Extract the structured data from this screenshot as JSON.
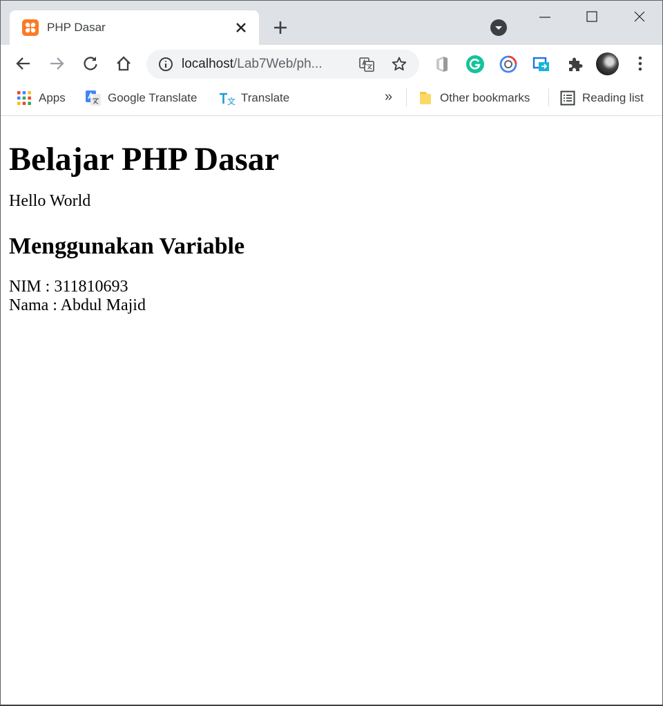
{
  "browser": {
    "tab": {
      "title": "PHP Dasar",
      "favicon": "xampp-icon"
    },
    "address_bar": {
      "host": "localhost",
      "path": "/Lab7Web/ph..."
    },
    "bookmarks": {
      "apps": "Apps",
      "google_translate": "Google Translate",
      "translate": "Translate",
      "more": "»",
      "other_bookmarks": "Other bookmarks",
      "reading_list": "Reading list"
    },
    "colors": {
      "tabstrip": "#dee1e6",
      "omnibox": "#f1f3f4",
      "favicon": "#fb7a24"
    }
  },
  "page": {
    "heading": "Belajar PHP Dasar",
    "hello": "Hello World",
    "subheading": "Menggunakan Variable",
    "nim_line": "NIM : 311810693",
    "nama_line": "Nama : Abdul Majid"
  }
}
